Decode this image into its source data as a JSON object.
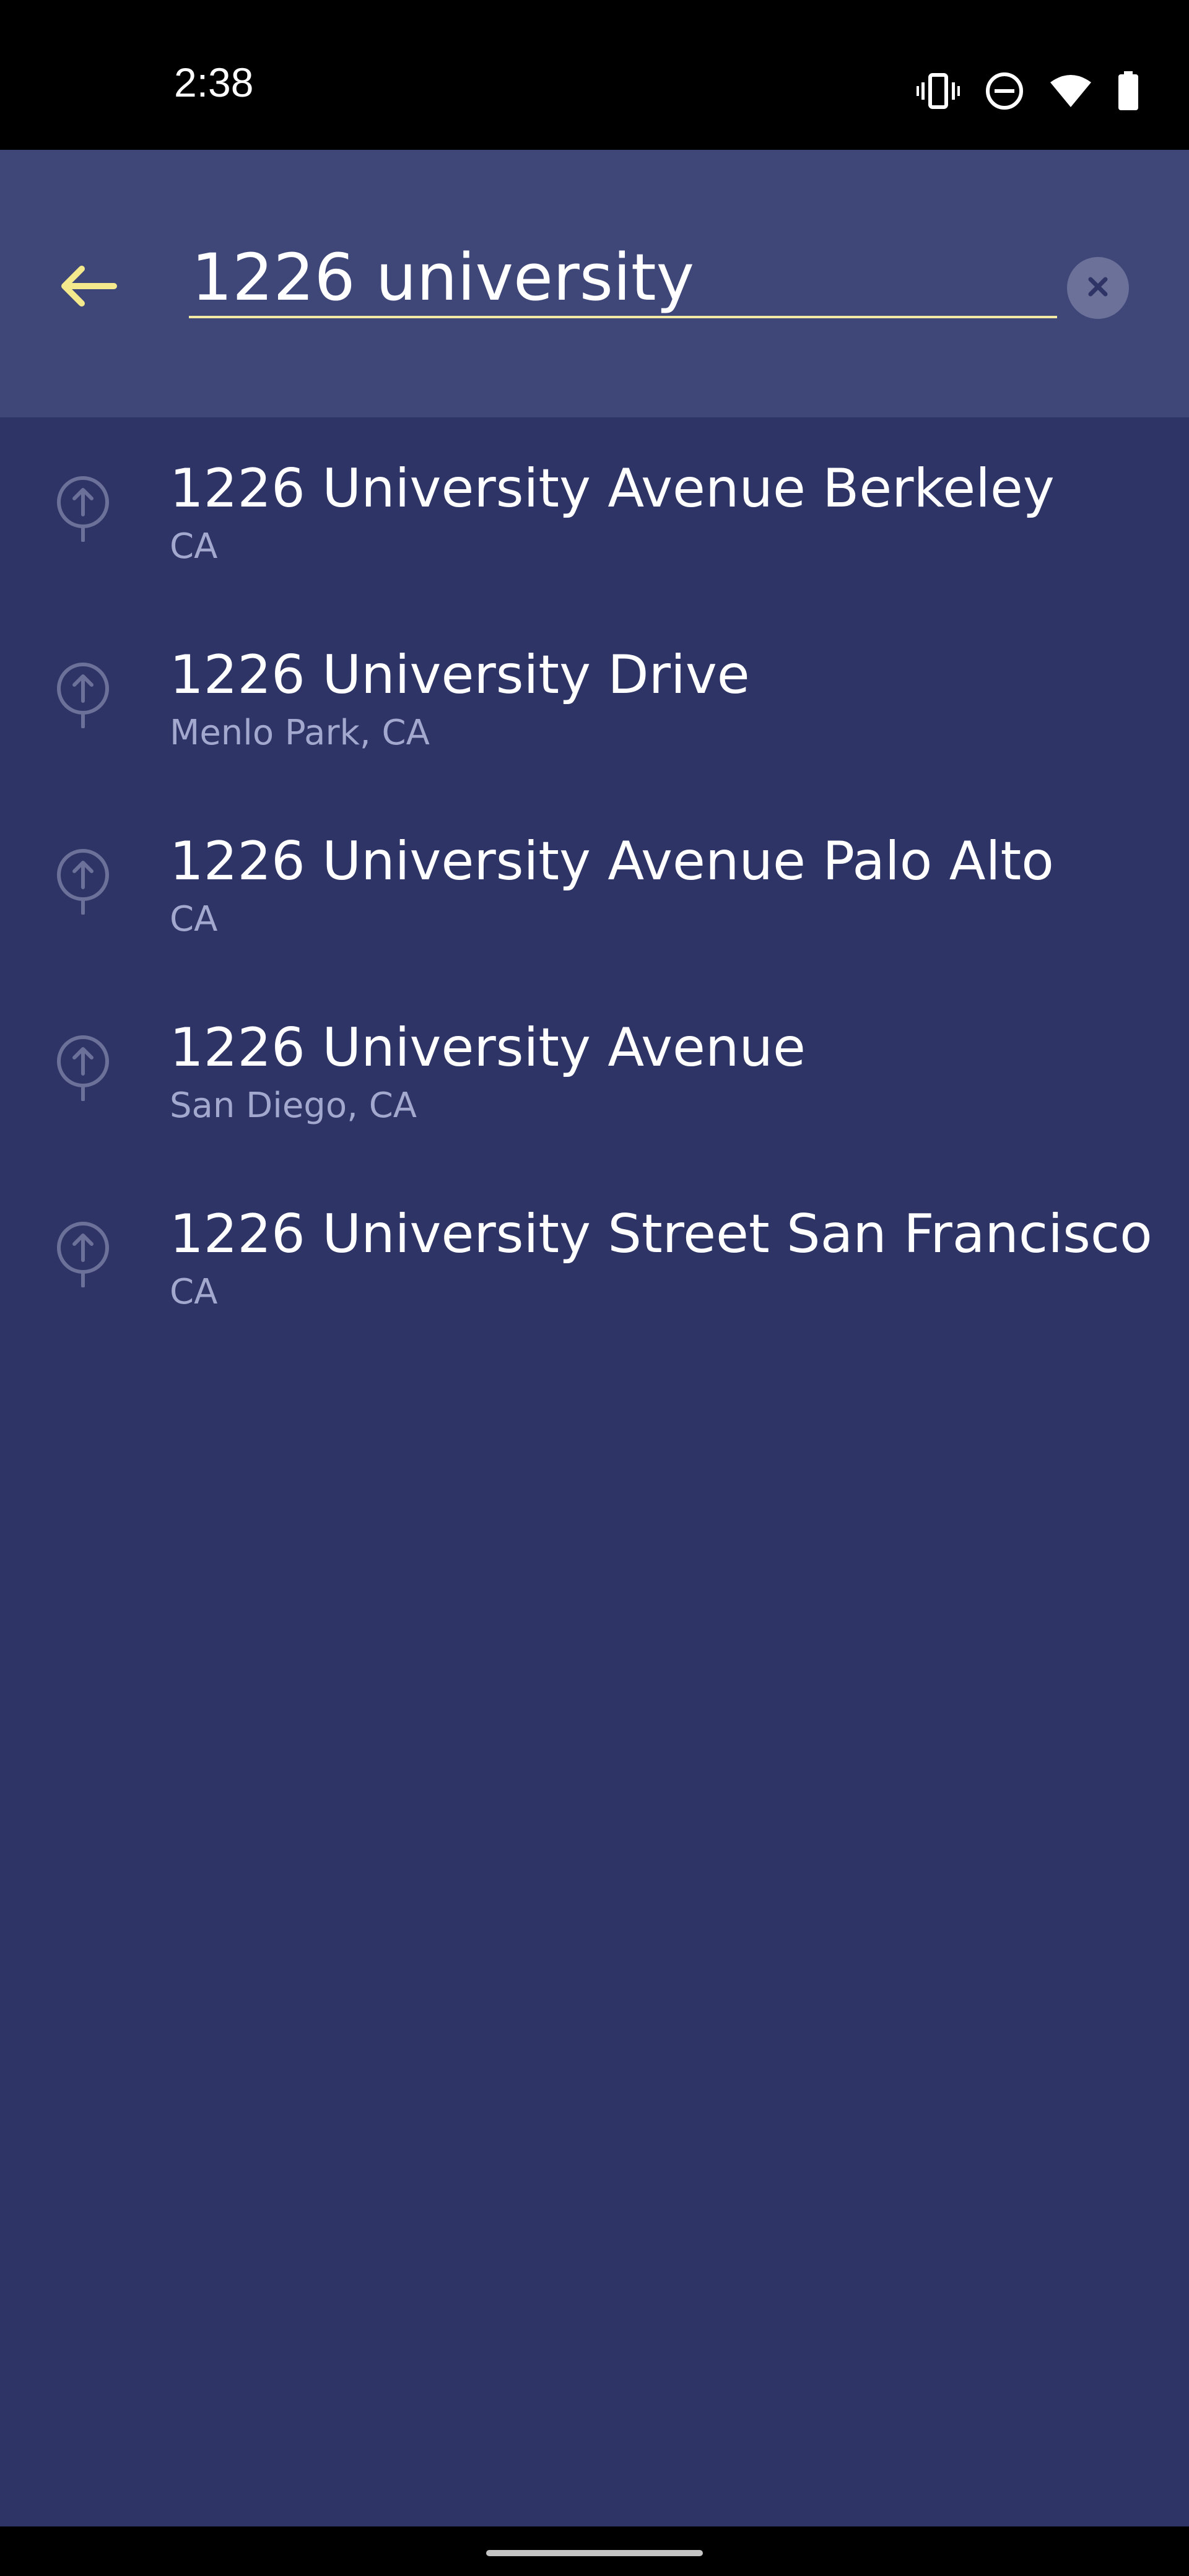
{
  "status_bar": {
    "time": "2:38",
    "icons": [
      "vibrate-icon",
      "do-not-disturb-icon",
      "wifi-icon",
      "battery-icon"
    ]
  },
  "search": {
    "value": "1226 university",
    "back_icon": "arrow-left-icon",
    "clear_icon": "close-icon",
    "accent_color": "#f4e98c"
  },
  "results": [
    {
      "title": "1226 University Avenue Berkeley",
      "subtitle": "CA"
    },
    {
      "title": "1226 University Drive",
      "subtitle": "Menlo Park, CA"
    },
    {
      "title": "1226 University Avenue Palo Alto",
      "subtitle": "CA"
    },
    {
      "title": "1226 University Avenue",
      "subtitle": "San Diego, CA"
    },
    {
      "title": "1226 University Street San Francisco",
      "subtitle": "CA"
    }
  ],
  "colors": {
    "background": "#2e3566",
    "header": "#3f4678",
    "subtitle": "#a3a8cf",
    "pin": "#6b7199"
  }
}
